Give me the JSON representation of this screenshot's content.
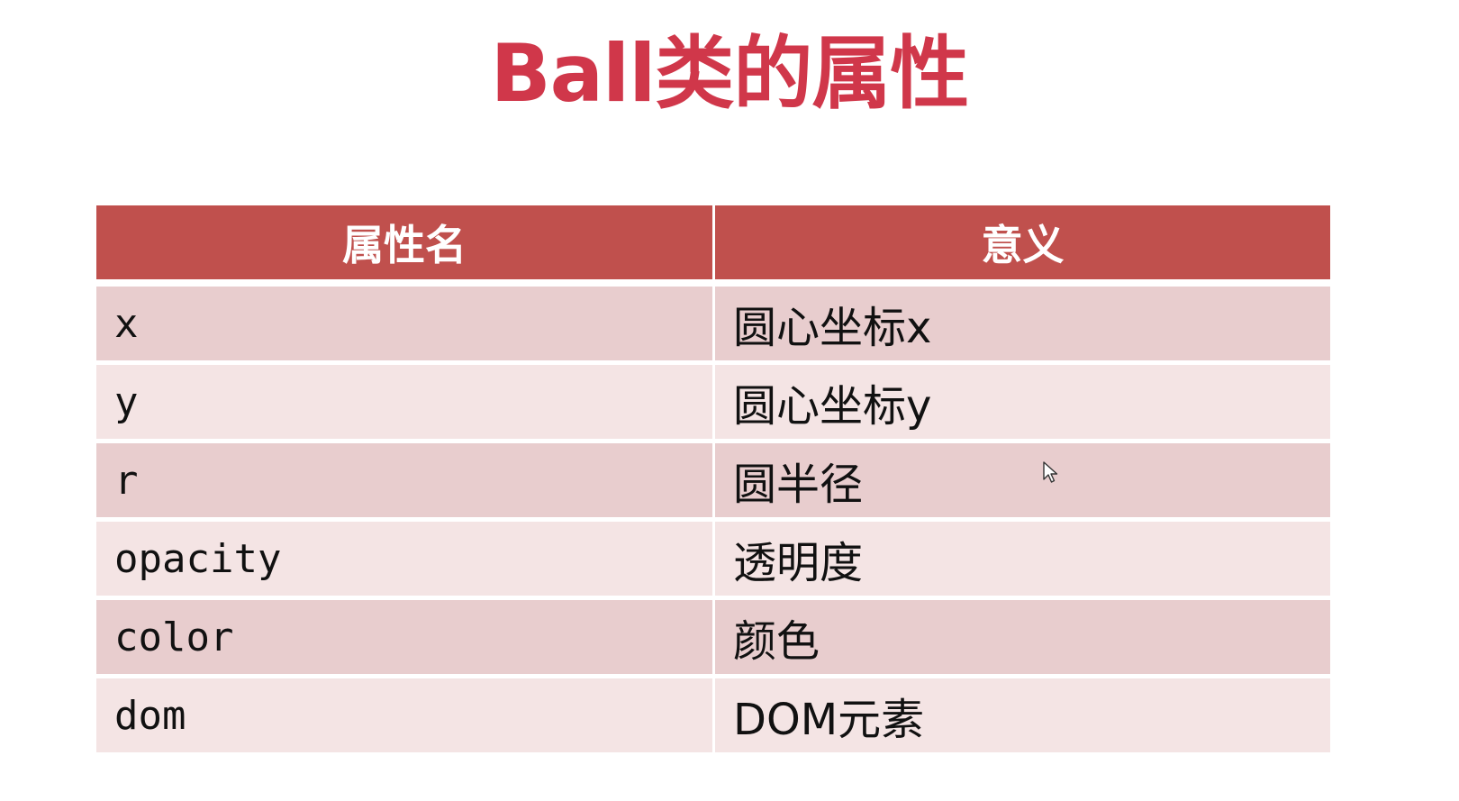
{
  "title": "Ball类的属性",
  "table": {
    "headers": [
      "属性名",
      "意义"
    ],
    "rows": [
      {
        "name": "x",
        "meaning": "圆心坐标x"
      },
      {
        "name": "y",
        "meaning": "圆心坐标y"
      },
      {
        "name": "r",
        "meaning": "圆半径"
      },
      {
        "name": "opacity",
        "meaning": "透明度"
      },
      {
        "name": "color",
        "meaning": "颜色"
      },
      {
        "name": "dom",
        "meaning": "DOM元素"
      }
    ]
  },
  "colors": {
    "title": "#d0374a",
    "header_bg": "#c0504d",
    "row_odd_bg": "#e8cdce",
    "row_even_bg": "#f4e4e4"
  },
  "icons": {
    "cursor": "mouse-pointer-icon"
  }
}
